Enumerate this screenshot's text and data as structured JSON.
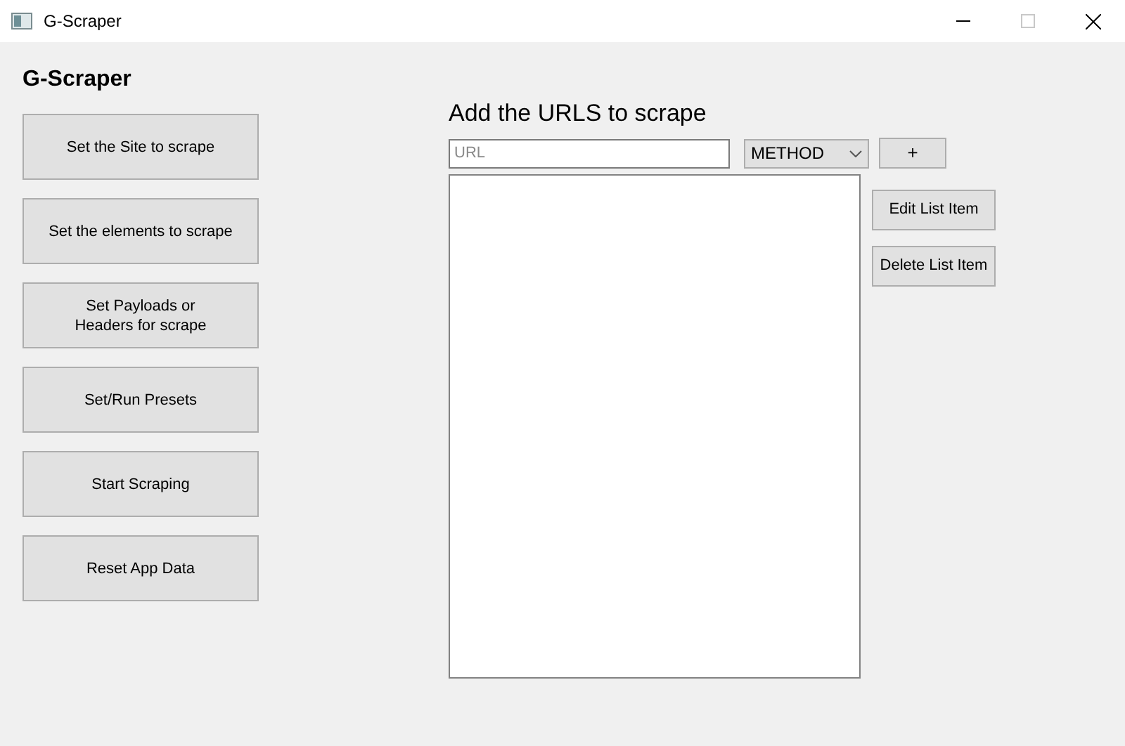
{
  "window": {
    "title": "G-Scraper"
  },
  "app_title": "G-Scraper",
  "nav_buttons": [
    "Set the Site to scrape",
    "Set the elements to scrape",
    "Set Payloads or\nHeaders for scrape",
    "Set/Run Presets",
    "Start Scraping",
    "Reset App Data"
  ],
  "panel": {
    "heading": "Add the URLS to scrape",
    "url_field": {
      "placeholder": "URL"
    },
    "method_select": {
      "value": "METHOD"
    },
    "add_button": "+",
    "list_actions": [
      "Edit List Item",
      "Delete List Item"
    ]
  }
}
